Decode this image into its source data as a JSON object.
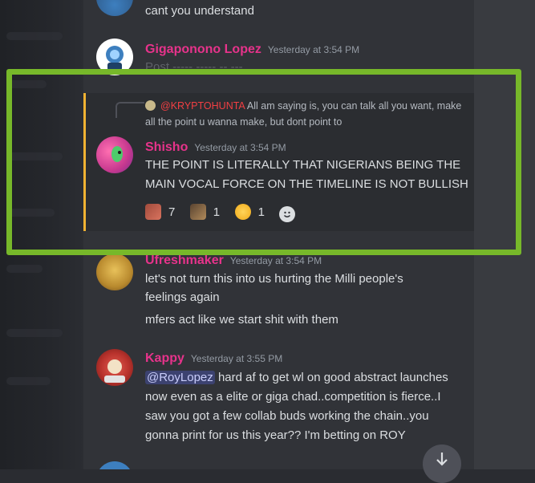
{
  "messages": {
    "top": {
      "text": "cant you understand"
    },
    "giga": {
      "author": "Gigaponono Lopez",
      "time": "Yesterday at 3:54 PM",
      "partial": "Post ----- ----- -- ---"
    },
    "shisho": {
      "reply": {
        "mention": "@KRYPTOHUNTA",
        "text": "All am saying is, you can talk all you want, make all the point u wanna make, but dont point to"
      },
      "author": "Shisho",
      "time": "Yesterday at 3:54 PM",
      "line1": "THE POINT IS LITERALLY THAT NIGERIANS BEING THE",
      "line2": "MAIN VOCAL FORCE ON THE TIMELINE IS NOT BULLISH",
      "reactions": [
        {
          "icon": "reaction-emoji-1",
          "count": "7"
        },
        {
          "icon": "reaction-emoji-2",
          "count": "1"
        },
        {
          "icon": "joy-emoji",
          "count": "1"
        }
      ]
    },
    "fresh": {
      "author": "Ufreshmaker",
      "time": "Yesterday at 3:54 PM",
      "line1": "let's not turn this into us hurting the Milli people's",
      "line2": "feelings again",
      "line3": "mfers act like we start shit with them"
    },
    "kappy": {
      "author": "Kappy",
      "time": "Yesterday at 3:55 PM",
      "mention": "@RoyLopez",
      "line1": "hard af to get wl on good abstract launches",
      "line2": "now even as a elite or giga chad..competition is fierce..I",
      "line3": "saw you got a few collab buds working the chain..you",
      "line4": "gonna print for us this year?? I'm betting on ROY"
    }
  },
  "colors": {
    "highlight_frame": "#77b82a",
    "name_pink": "#e7338b",
    "mention_red": "#f23f43",
    "bar_gold": "#f0b232"
  }
}
